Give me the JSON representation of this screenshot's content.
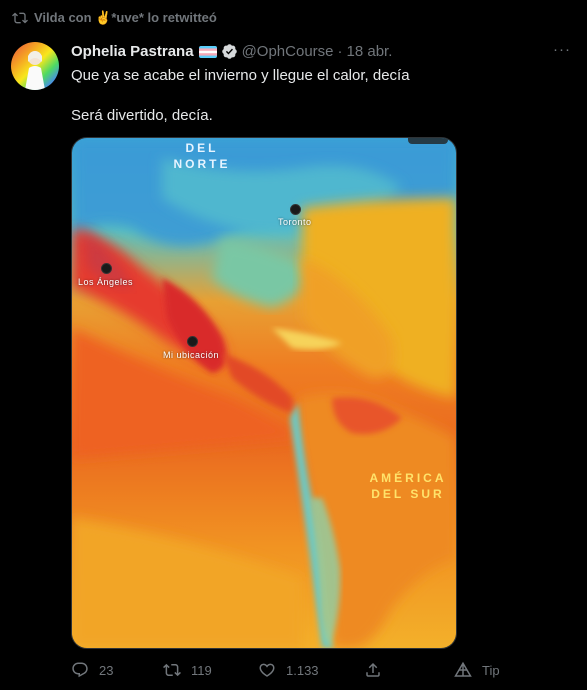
{
  "retweet": {
    "text": "Vilda con ✌️*uve* lo retwitteó"
  },
  "tweet": {
    "author_name": "Ophelia Pastrana",
    "handle": "@OphCourse",
    "separator": "·",
    "date": "18 abr.",
    "more": "···",
    "line1": "Que ya se acabe el invierno y llegue el calor, decía",
    "line2": "Será divertido, decía."
  },
  "map": {
    "region_top_1": "DEL",
    "region_top_2": "NORTE",
    "city_toronto": "Toronto",
    "city_la": "Los Ángeles",
    "my_location": "Mi ubicación",
    "region_south_1": "AMÉRICA",
    "region_south_2": "DEL SUR"
  },
  "actions": {
    "replies": "23",
    "retweets": "119",
    "likes": "1.133",
    "tip": "Tip"
  },
  "colors": {
    "background": "#000000",
    "muted": "#71767b",
    "text": "#e7e9ea",
    "region_label_yellow": "#ffe36b"
  }
}
